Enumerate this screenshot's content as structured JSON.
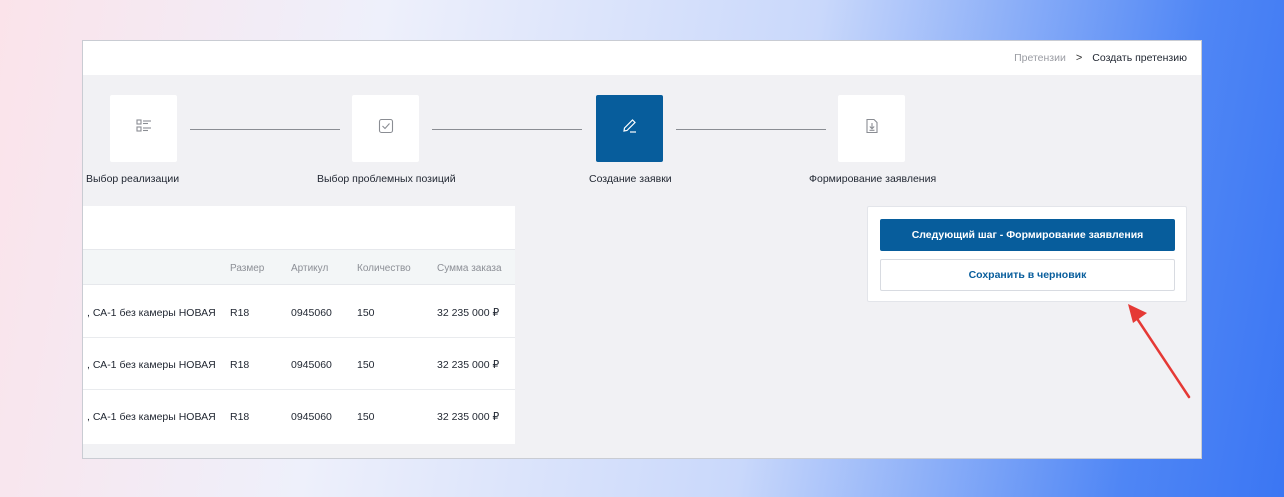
{
  "breadcrumb": {
    "parent": "Претензии",
    "separator": ">",
    "current": "Создать претензию"
  },
  "stepper": {
    "steps": [
      {
        "label": "Выбор реализации",
        "icon": "list-icon",
        "state": "done"
      },
      {
        "label": "Выбор проблемных позиций",
        "icon": "checkbox-icon",
        "state": "done"
      },
      {
        "label": "Создание заявки",
        "icon": "pencil-icon",
        "state": "active"
      },
      {
        "label": "Формирование заявления",
        "icon": "document-download-icon",
        "state": "pending"
      }
    ]
  },
  "table": {
    "columns": [
      "Размер",
      "Артикул",
      "Количество",
      "Сумма заказа"
    ],
    "rows": [
      {
        "name": ", СА-1 без камеры НОВАЯ",
        "size": "R18",
        "article": "0945060",
        "qty": "150",
        "sum": "32 235 000 ₽"
      },
      {
        "name": ", СА-1 без камеры НОВАЯ",
        "size": "R18",
        "article": "0945060",
        "qty": "150",
        "sum": "32 235 000 ₽"
      },
      {
        "name": ", СА-1 без камеры НОВАЯ",
        "size": "R18",
        "article": "0945060",
        "qty": "150",
        "sum": "32 235 000 ₽"
      }
    ]
  },
  "actions": {
    "next_label": "Следующий шаг - Формирование заявления",
    "draft_label": "Сохранить в черновик"
  },
  "colors": {
    "primary": "#075d9c",
    "annotation_arrow": "#e53935"
  }
}
